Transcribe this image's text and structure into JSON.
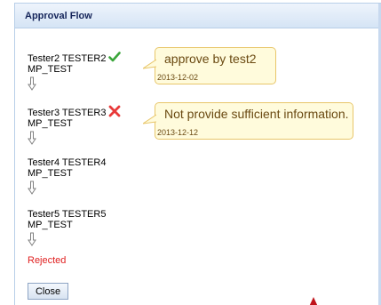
{
  "panel": {
    "title": "Approval Flow"
  },
  "steps": [
    {
      "name": "Tester2 TESTER2",
      "dept": "MP_TEST",
      "status": "approved",
      "status_icon": "checkmark-icon",
      "comment": {
        "text": "approve by test2",
        "date": "2013-12-02"
      }
    },
    {
      "name": "Tester3 TESTER3",
      "dept": "MP_TEST",
      "status": "rejected",
      "status_icon": "x-icon",
      "comment": {
        "text": "Not provide sufficient information.",
        "date": "2013-12-12"
      }
    },
    {
      "name": "Tester4 TESTER4",
      "dept": "MP_TEST"
    },
    {
      "name": "Tester5 TESTER5",
      "dept": "MP_TEST"
    }
  ],
  "final_status": "Rejected",
  "buttons": {
    "close": "Close"
  },
  "colors": {
    "approve": "#3aa53a",
    "reject": "#e83a3a",
    "rejected_text": "#e02020",
    "bubble_bg": "#fffbdc",
    "bubble_border": "#e8c66a"
  }
}
